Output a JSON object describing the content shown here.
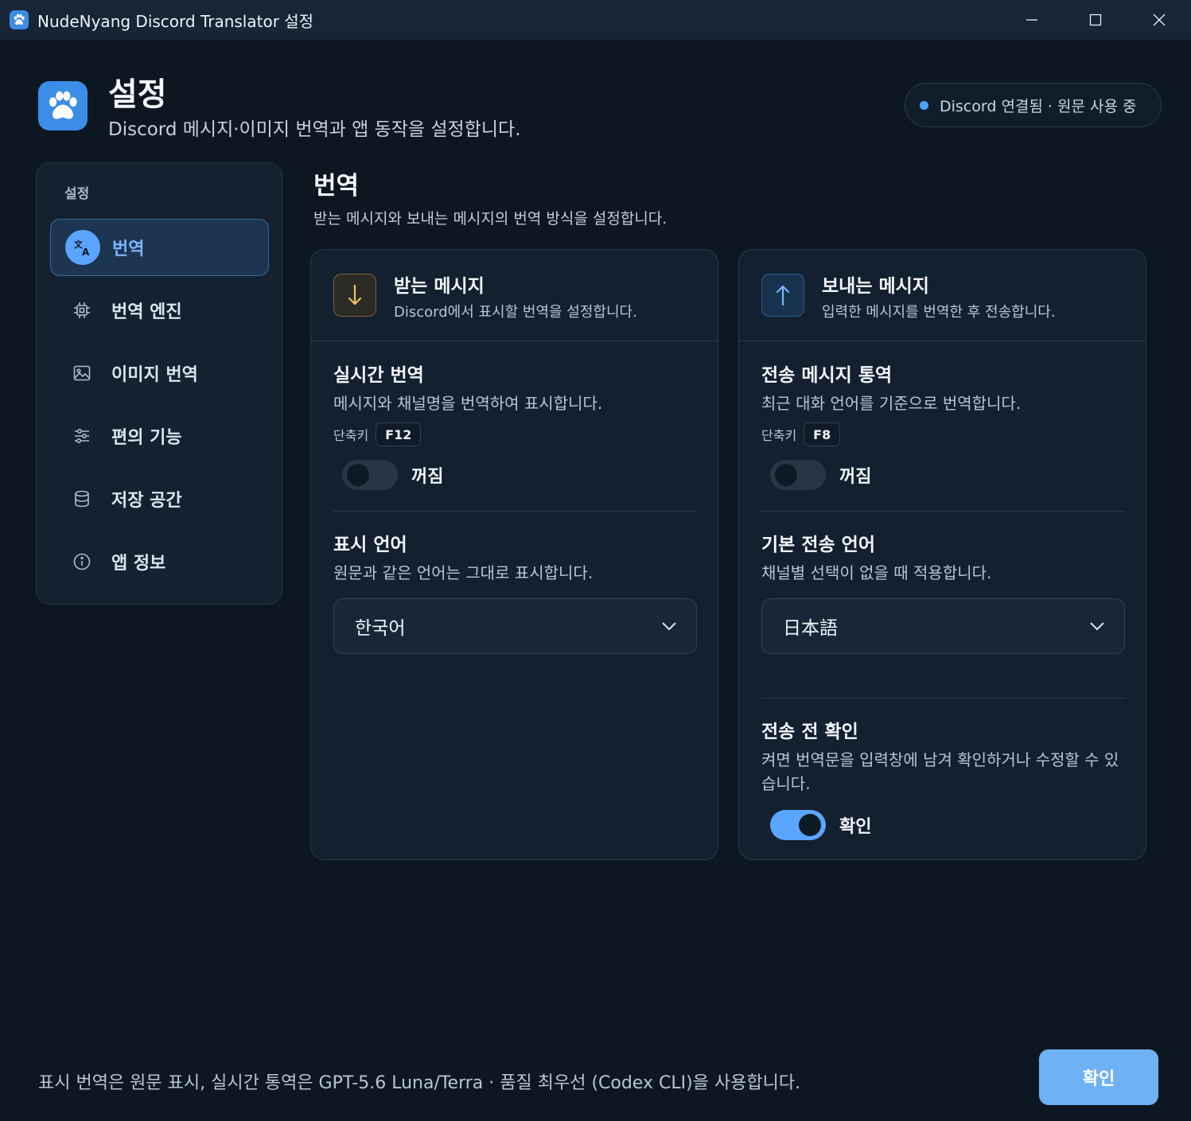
{
  "window": {
    "title": "NudeNyang Discord Translator 설정",
    "icon": "paw-icon"
  },
  "header": {
    "title": "설정",
    "subtitle": "Discord 메시지·이미지 번역과 앱 동작을 설정합니다.",
    "status": "Discord 연결됨 · 원문 사용 중",
    "status_color": "#4fa3ff"
  },
  "sidebar": {
    "heading": "설정",
    "items": [
      {
        "label": "번역",
        "icon": "translate-icon",
        "active": true
      },
      {
        "label": "번역 엔진",
        "icon": "chip-icon",
        "active": false
      },
      {
        "label": "이미지 번역",
        "icon": "image-icon",
        "active": false
      },
      {
        "label": "편의 기능",
        "icon": "sliders-icon",
        "active": false
      },
      {
        "label": "저장 공간",
        "icon": "database-icon",
        "active": false
      },
      {
        "label": "앱 정보",
        "icon": "info-icon",
        "active": false
      }
    ]
  },
  "section": {
    "title": "번역",
    "description": "받는 메시지와 보내는 메시지의 번역 방식을 설정합니다."
  },
  "incoming": {
    "title": "받는 메시지",
    "subtitle": "Discord에서 표시할 번역을 설정합니다.",
    "icon": "arrow-down-icon",
    "realtime": {
      "title": "실시간 번역",
      "description": "메시지와 채널명을 번역하여 표시합니다.",
      "shortcut_label": "단축키",
      "shortcut_key": "F12",
      "toggle_label": "꺼짐",
      "enabled": false
    },
    "display_language": {
      "title": "표시 언어",
      "description": "원문과 같은 언어는 그대로 표시합니다.",
      "value": "한국어"
    }
  },
  "outgoing": {
    "title": "보내는 메시지",
    "subtitle": "입력한 메시지를 번역한 후 전송합니다.",
    "icon": "arrow-up-icon",
    "interpret": {
      "title": "전송 메시지 통역",
      "description": "최근 대화 언어를 기준으로 번역합니다.",
      "shortcut_label": "단축키",
      "shortcut_key": "F8",
      "toggle_label": "꺼짐",
      "enabled": false
    },
    "default_language": {
      "title": "기본 전송 언어",
      "description": "채널별 선택이 없을 때 적용합니다.",
      "value": "日本語"
    },
    "confirm_before_send": {
      "title": "전송 전 확인",
      "description": "켜면 번역문을 입력창에 남겨 확인하거나 수정할 수 있습니다.",
      "toggle_label": "확인",
      "enabled": true
    }
  },
  "footer": {
    "info": "표시 번역은 원문 표시, 실시간 통역은 GPT-5.6 Luna/Terra · 품질 최우선 (Codex CLI)을 사용합니다.",
    "confirm_label": "확인"
  },
  "colors": {
    "accent": "#5aa5ff",
    "background": "#0d1722",
    "card": "#132030",
    "confirm_button": "#6fb1f5"
  }
}
